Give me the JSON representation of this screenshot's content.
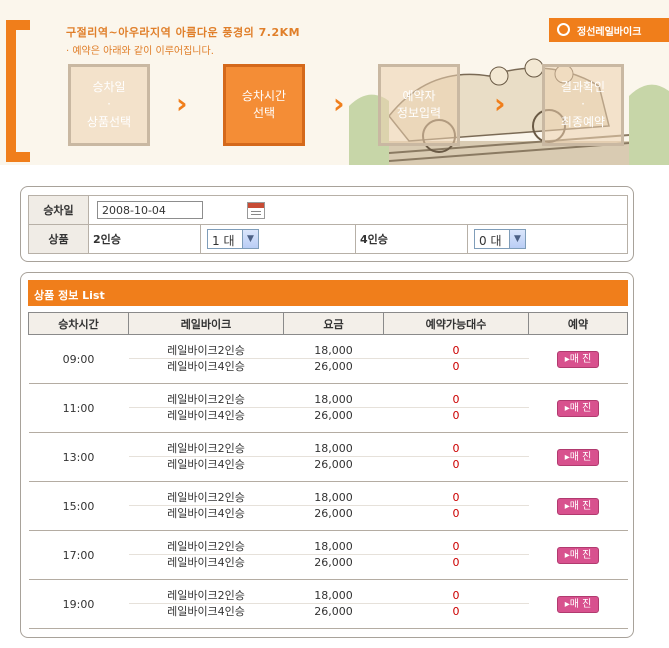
{
  "banner": {
    "title": "구절리역~아우라지역 아름다운 풍경의 7.2KM",
    "subtitle": "· 예약은 아래와 같이 이루어집니다.",
    "brand": "정선레일바이크",
    "steps": [
      {
        "line1": "승차일",
        "line2": "·",
        "line3": "상품선택"
      },
      {
        "line1": "승차시간",
        "line2": "선택",
        "line3": ""
      },
      {
        "line1": "예약자",
        "line2": "정보입력",
        "line3": ""
      },
      {
        "line1": "결과확인",
        "line2": "·",
        "line3": "최종예약"
      }
    ]
  },
  "search": {
    "date_label": "승차일",
    "date_value": "2008-10-04",
    "product_label": "상품",
    "opt2_label": "2인승",
    "opt2_value": "1 대",
    "opt4_label": "4인승",
    "opt4_value": "0 대"
  },
  "list": {
    "title": "상품 정보 List",
    "headers": [
      "승차시간",
      "레일바이크",
      "요금",
      "예약가능대수",
      "예약"
    ],
    "rows": [
      {
        "time": "09:00",
        "p1": "레일바이크2인승",
        "p2": "레일바이크4인승",
        "f1": "18,000",
        "f2": "26,000",
        "a1": "0",
        "a2": "0",
        "btn": "▸매 진"
      },
      {
        "time": "11:00",
        "p1": "레일바이크2인승",
        "p2": "레일바이크4인승",
        "f1": "18,000",
        "f2": "26,000",
        "a1": "0",
        "a2": "0",
        "btn": "▸매 진"
      },
      {
        "time": "13:00",
        "p1": "레일바이크2인승",
        "p2": "레일바이크4인승",
        "f1": "18,000",
        "f2": "26,000",
        "a1": "0",
        "a2": "0",
        "btn": "▸매 진"
      },
      {
        "time": "15:00",
        "p1": "레일바이크2인승",
        "p2": "레일바이크4인승",
        "f1": "18,000",
        "f2": "26,000",
        "a1": "0",
        "a2": "0",
        "btn": "▸매 진"
      },
      {
        "time": "17:00",
        "p1": "레일바이크2인승",
        "p2": "레일바이크4인승",
        "f1": "18,000",
        "f2": "26,000",
        "a1": "0",
        "a2": "0",
        "btn": "▸매 진"
      },
      {
        "time": "19:00",
        "p1": "레일바이크2인승",
        "p2": "레일바이크4인승",
        "f1": "18,000",
        "f2": "26,000",
        "a1": "0",
        "a2": "0",
        "btn": "▸매 진"
      }
    ]
  },
  "colors": {
    "accent": "#f07e1b",
    "soldout": "#d8518e",
    "avail": "#cc0000"
  }
}
